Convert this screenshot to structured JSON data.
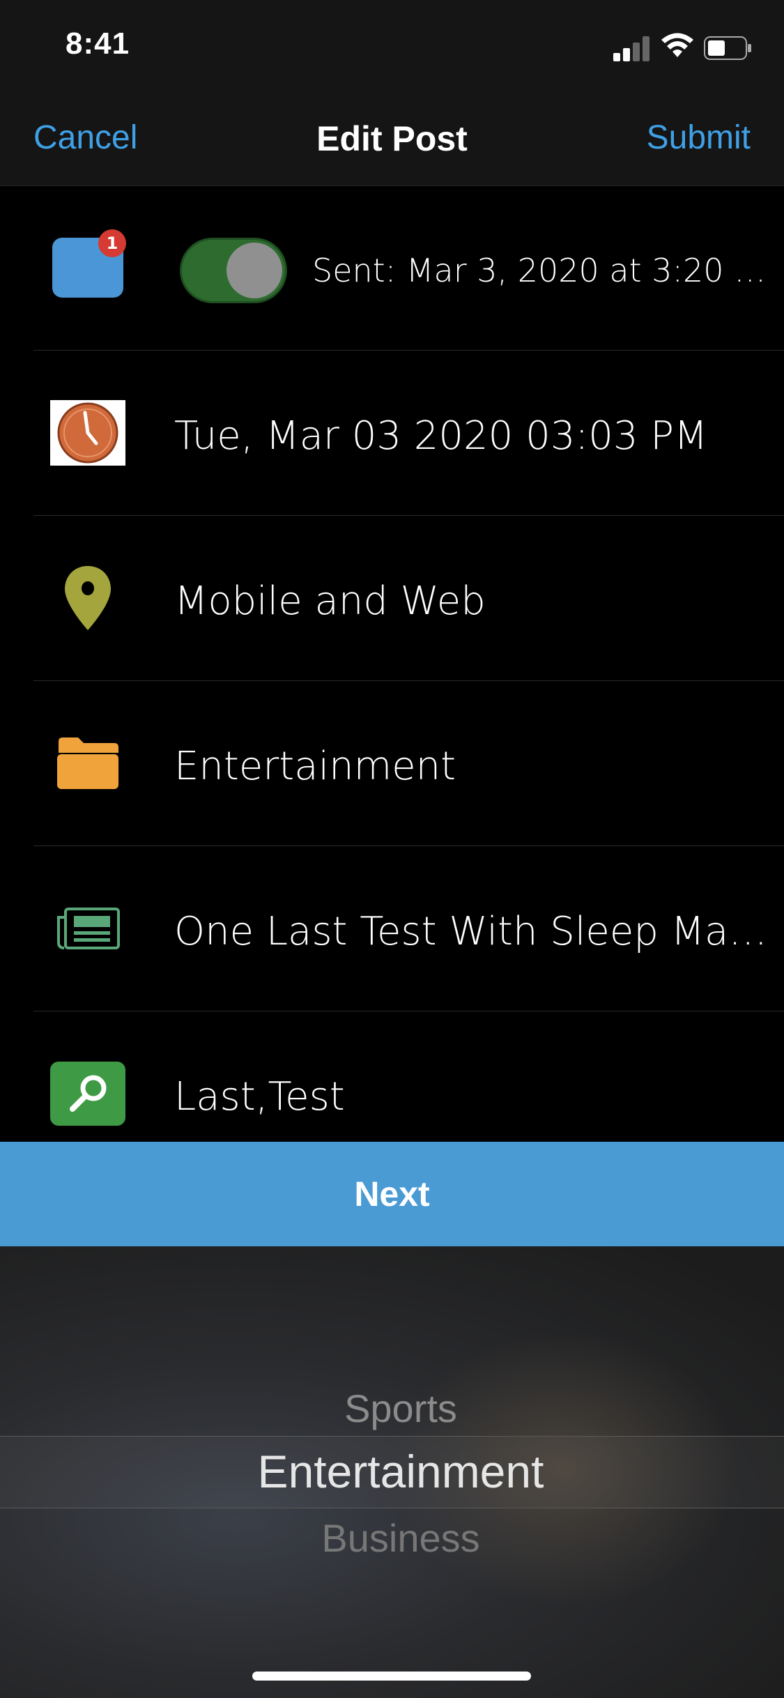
{
  "status_bar": {
    "time": "8:41"
  },
  "nav": {
    "cancel_label": "Cancel",
    "title": "Edit Post",
    "submit_label": "Submit"
  },
  "rows": {
    "notification": {
      "badge_count": "1",
      "sent_text": "Sent: Mar 3, 2020 at 3:20 P...",
      "toggle_on": true
    },
    "datetime": {
      "label": "Tue, Mar 03 2020 03:03 PM"
    },
    "location": {
      "label": "Mobile and Web"
    },
    "category": {
      "label": "Entertainment"
    },
    "publication": {
      "label": "One Last Test With Sleep Magazin..."
    },
    "tags": {
      "label": "Last,Test"
    }
  },
  "next_button": {
    "label": "Next"
  },
  "picker": {
    "above": "Sports",
    "selected": "Entertainment",
    "below": "Business"
  },
  "colors": {
    "accent": "#3fa0e6",
    "next_button": "#4a9ad4",
    "toggle_on": "#2d6b2f",
    "badge": "#d53a33",
    "folder": "#f0a23b",
    "pin": "#a5a53d",
    "clock": "#d06a3a",
    "search": "#3f9a45",
    "newspaper": "#5aa87a"
  },
  "icons": {
    "notification": "notification-square-icon",
    "datetime": "clock-icon",
    "location": "map-pin-icon",
    "category": "folder-icon",
    "publication": "newspaper-icon",
    "tags": "search-icon"
  }
}
